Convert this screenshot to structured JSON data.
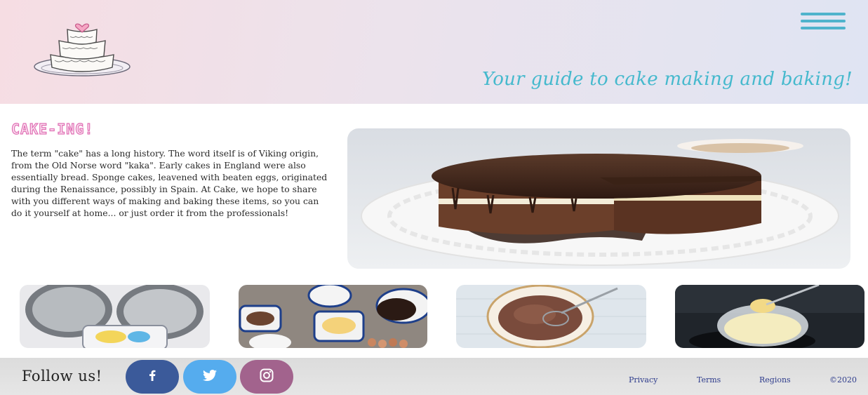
{
  "header": {
    "tagline": "Your guide to cake making and baking!",
    "logo_icon": "tiered-cake-logo",
    "menu_icon": "hamburger-menu-icon",
    "tagline_color": "#45b9cd",
    "menu_color": "#4fb3cc"
  },
  "intro": {
    "title": "CAKE-ING!",
    "title_color": "#e06fb4",
    "paragraph": "The term \"cake\" has a long history. The word itself is of Viking origin, from the Old Norse word \"kaka\". Early cakes in England were also essentially bread. Sponge cakes, leavened with beaten eggs, originated during the Renaissance, possibly in Spain. At Cake, we hope to share with you different ways of making and baking these items, so you can do it yourself at home... or just order it from the professionals!"
  },
  "gallery": {
    "hero": "chocolate-layer-cake-photo",
    "thumbnails": [
      "cake-tins-photo",
      "baking-ingredients-photo",
      "chocolate-batter-bowl-photo",
      "whisking-butter-photo"
    ]
  },
  "footer": {
    "follow_label": "Follow us!",
    "social": [
      {
        "name": "facebook",
        "icon": "facebook-icon",
        "color": "#3b5a9a"
      },
      {
        "name": "twitter",
        "icon": "twitter-icon",
        "color": "#55acee"
      },
      {
        "name": "instagram",
        "icon": "instagram-icon",
        "color": "#a2638d"
      }
    ],
    "links": [
      "Privacy",
      "Terms",
      "Regions"
    ],
    "copyright": "©2020",
    "link_color": "#2e3c8c"
  }
}
